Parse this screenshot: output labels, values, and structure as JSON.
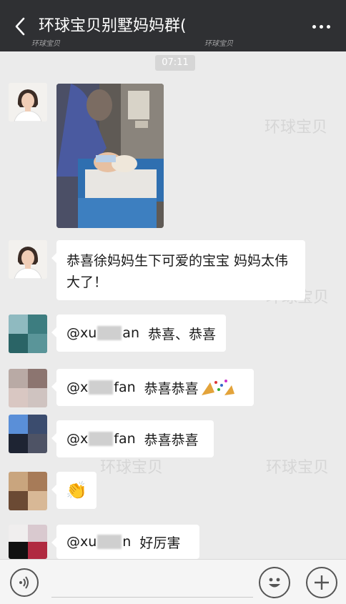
{
  "header": {
    "title": "环球宝贝别墅妈妈群(",
    "back_icon": "chevron-left-icon",
    "more_icon": "more-dots-icon",
    "watermark": "环球宝贝"
  },
  "watermark_text": "环球宝贝",
  "timestamp": "07:11",
  "messages": [
    {
      "type": "image",
      "avatar": "avatar-woman",
      "caption": ""
    },
    {
      "type": "text",
      "text": "恭喜徐妈妈生下可爱的宝宝 妈妈太伟大了！"
    },
    {
      "type": "text",
      "mention": "@xu",
      "mention_tail": "an",
      "text": "恭喜、恭喜"
    },
    {
      "type": "text",
      "mention": "@x",
      "mention_tail": "fan",
      "text": "恭喜恭喜"
    },
    {
      "type": "text",
      "mention": "@x",
      "mention_tail": "fan",
      "text": "恭喜恭喜"
    },
    {
      "type": "emoji",
      "text": "👏"
    },
    {
      "type": "text",
      "mention": "@xu",
      "mention_tail": "n",
      "text": "好厉害"
    }
  ],
  "input_bar": {
    "voice_icon": "voice-icon",
    "emoji_icon": "smiley-icon",
    "plus_icon": "plus-icon"
  }
}
